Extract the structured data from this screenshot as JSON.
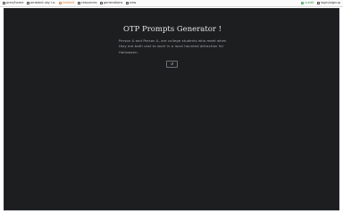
{
  "topbar": {
    "left": [
      {
        "label": "prev/home",
        "icon": "home-icon"
      },
      {
        "label": "ambient sky i.e.",
        "icon": "cloud-icon"
      },
      {
        "label": "teletalk",
        "icon": "tag-icon",
        "active": true
      },
      {
        "label": "resources",
        "icon": "book-icon"
      },
      {
        "label": "generations",
        "icon": "sparkle-icon"
      },
      {
        "label": "new",
        "icon": "plus-icon"
      }
    ],
    "right": [
      {
        "label": "credit",
        "icon": "coin-icon"
      },
      {
        "label": "login/signup",
        "icon": "user-icon"
      }
    ]
  },
  "main": {
    "title": "OTP Prompts Generator !",
    "description": "Person A and Person A, are college students who meet when they are both cast to work in a local haunted attraction for Halloween.",
    "generate_label": "↺"
  },
  "colors": {
    "stage_bg": "#1d1e20",
    "accent_active": "#e8863a",
    "credit_green": "#2e9e4f"
  }
}
